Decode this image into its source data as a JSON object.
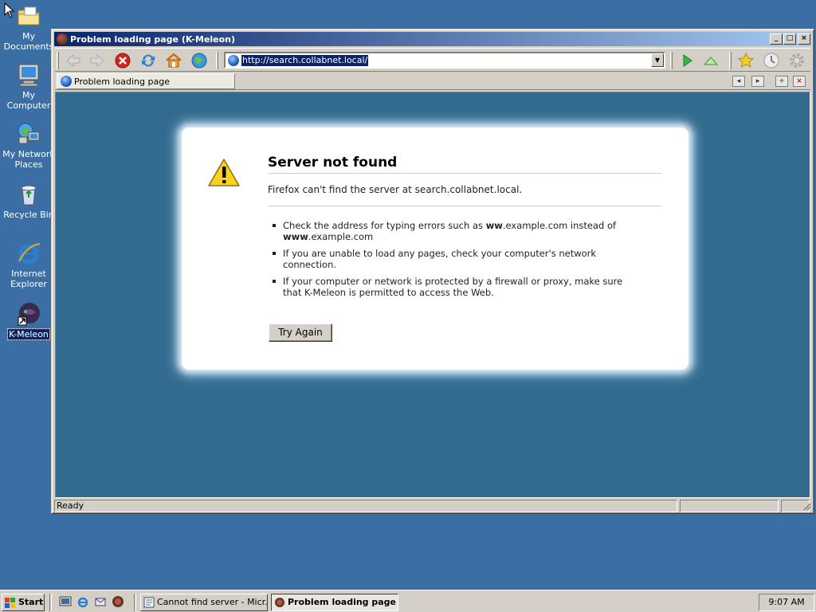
{
  "desktop": {
    "icons": [
      {
        "label": "My Documents",
        "icon": "folder-icon"
      },
      {
        "label": "My Computer",
        "icon": "computer-icon"
      },
      {
        "label": "My Network Places",
        "icon": "network-icon"
      },
      {
        "label": "Recycle Bin",
        "icon": "recycle-bin-icon"
      },
      {
        "label": "Internet Explorer",
        "icon": "internet-explorer-icon"
      },
      {
        "label": "K-Meleon",
        "icon": "k-meleon-icon"
      }
    ]
  },
  "window": {
    "title": "Problem loading page (K-Meleon)",
    "controls": {
      "minimize": "_",
      "maximize": "□",
      "close": "×"
    },
    "toolbar": {
      "icons": [
        "back-icon",
        "forward-icon",
        "stop-icon",
        "reload-icon",
        "home-icon",
        "globe-icon",
        "go-icon",
        "up-icon",
        "bookmark-star-icon",
        "history-icon",
        "settings-gear-icon"
      ],
      "url": "http://search.collabnet.local/"
    },
    "tab": {
      "label": "Problem loading page"
    },
    "error": {
      "title": "Server not found",
      "short": "Firefox can't find the server at search.collabnet.local.",
      "bullet1_pre": "Check the address for typing errors such as ",
      "bullet1_bold1": "ww",
      "bullet1_mid": ".example.com instead of ",
      "bullet1_bold2": "www",
      "bullet1_post": ".example.com",
      "bullet2": "If you are unable to load any pages, check your computer's network connection.",
      "bullet3": "If your computer or network is protected by a firewall or proxy, make sure that K-Meleon is permitted to access the Web.",
      "try_again": "Try Again"
    },
    "status": {
      "text": "Ready"
    }
  },
  "taskbar": {
    "start": "Start",
    "tasks": [
      {
        "label": "Cannot find server - Micr...",
        "active": false
      },
      {
        "label": "Problem loading page ...",
        "active": true
      }
    ],
    "clock": "9:07 AM"
  },
  "colors": {
    "desktop": "#3a6ea5",
    "content_bg": "#336a8f",
    "title_gradient_start": "#0a246a",
    "title_gradient_end": "#a6caf0"
  }
}
